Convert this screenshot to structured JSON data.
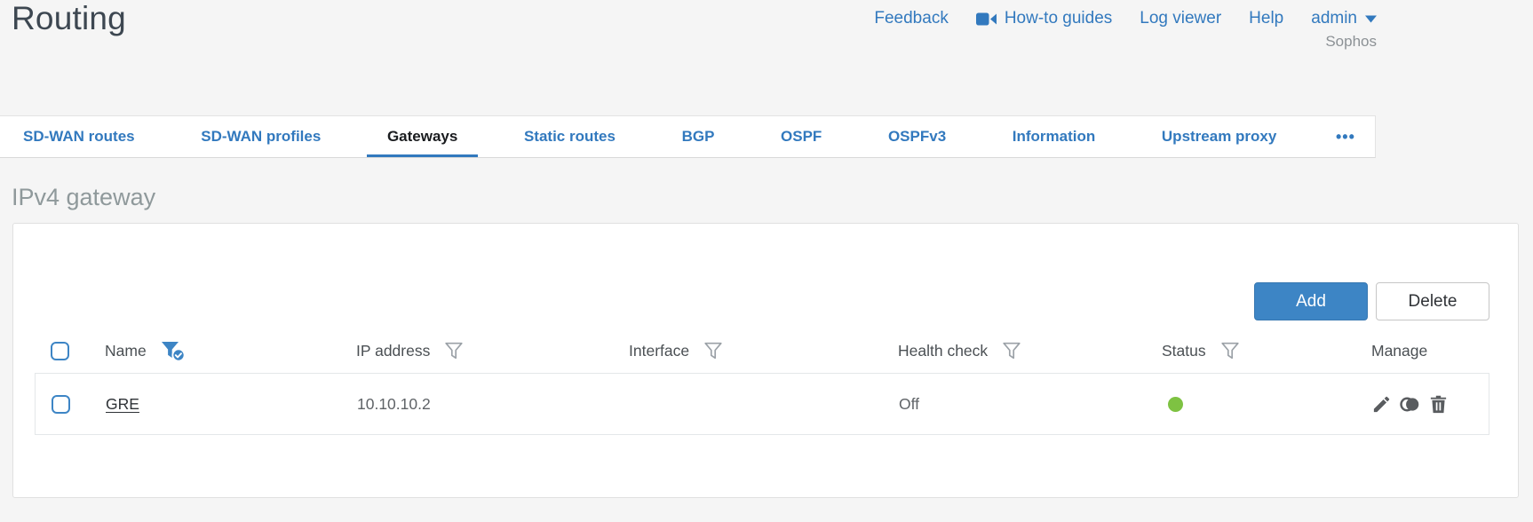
{
  "app": {
    "title": "Routing",
    "brand": "Sophos"
  },
  "header": {
    "links": [
      {
        "label": "Feedback"
      },
      {
        "label": "How-to guides",
        "icon": "video-icon"
      },
      {
        "label": "Log viewer"
      },
      {
        "label": "Help"
      },
      {
        "label": "admin",
        "icon": "caret-down-icon"
      }
    ]
  },
  "tabs": [
    {
      "label": "SD-WAN routes"
    },
    {
      "label": "SD-WAN profiles"
    },
    {
      "label": "Gateways",
      "active": true
    },
    {
      "label": "Static routes"
    },
    {
      "label": "BGP"
    },
    {
      "label": "OSPF"
    },
    {
      "label": "OSPFv3"
    },
    {
      "label": "Information"
    },
    {
      "label": "Upstream proxy"
    },
    {
      "label": "•••",
      "more": true
    }
  ],
  "section": {
    "title": "IPv4 gateway"
  },
  "toolbar": {
    "add": "Add",
    "delete": "Delete"
  },
  "table": {
    "columns": [
      {
        "label": "Name",
        "filter": "active"
      },
      {
        "label": "IP address",
        "filter": "default"
      },
      {
        "label": "Interface",
        "filter": "default"
      },
      {
        "label": "Health check",
        "filter": "default"
      },
      {
        "label": "Status",
        "filter": "default"
      },
      {
        "label": "Manage",
        "filter": "none"
      }
    ],
    "rows": [
      {
        "name": "GRE",
        "ip_address": "10.10.10.2",
        "interface": "",
        "health_check": "Off",
        "status": "up",
        "manage_icons": [
          "edit-icon",
          "clone-icon",
          "delete-icon"
        ]
      }
    ]
  },
  "colors": {
    "accent_blue": "#3279be",
    "button_blue": "#3d85c5",
    "status_up_green": "#7ec242",
    "title_gray": "#3d4751",
    "section_gray": "#8f999b"
  }
}
